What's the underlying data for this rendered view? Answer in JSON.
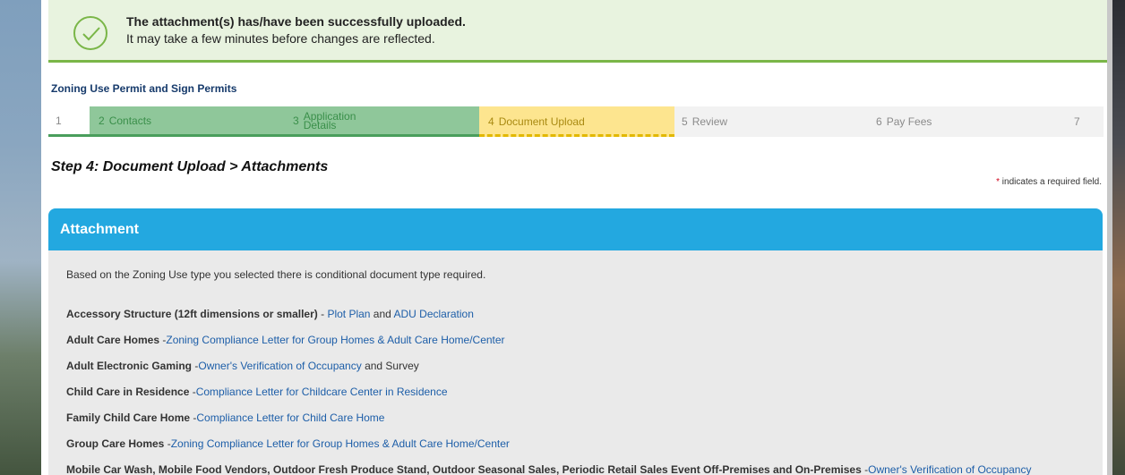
{
  "notice": {
    "title": "The attachment(s) has/have been successfully uploaded.",
    "subtitle": "It may take a few minutes before changes are reflected.",
    "icon": "check-circle-icon",
    "color": "#7ab648"
  },
  "permit_title": "Zoning Use Permit and Sign Permits",
  "steps": [
    {
      "num": "1",
      "label": "",
      "state": "done-partial"
    },
    {
      "num": "2",
      "label": "Contacts",
      "state": "done"
    },
    {
      "num": "3",
      "label": "Application",
      "label2": "Details",
      "state": "done"
    },
    {
      "num": "4",
      "label": "Document Upload",
      "state": "active"
    },
    {
      "num": "5",
      "label": "Review",
      "state": "pending"
    },
    {
      "num": "6",
      "label": "Pay Fees",
      "state": "pending"
    },
    {
      "num": "7",
      "label": "",
      "state": "pending"
    }
  ],
  "step_heading": "Step 4: Document Upload > Attachments",
  "required_note": {
    "star": "*",
    "text": " indicates a required field."
  },
  "panel": {
    "title": "Attachment",
    "intro": "Based on the Zoning Use type you selected there is conditional document type required.",
    "rows": [
      {
        "label": "Accessory Structure (12ft dimensions or smaller)",
        "sep": " - ",
        "link1": "Plot Plan",
        "mid": " and ",
        "link2": "ADU Declaration",
        "tail": ""
      },
      {
        "label": "Adult Care Homes",
        "sep": " -",
        "link1": "Zoning Compliance Letter for Group Homes & Adult Care Home/Center",
        "mid": "",
        "link2": "",
        "tail": ""
      },
      {
        "label": "Adult Electronic Gaming",
        "sep": " -",
        "link1": "Owner's Verification of Occupancy",
        "mid": " and Survey",
        "link2": "",
        "tail": ""
      },
      {
        "label": "Child Care in Residence",
        "sep": " -",
        "link1": "Compliance Letter for Childcare Center in Residence",
        "mid": "",
        "link2": "",
        "tail": ""
      },
      {
        "label": "Family Child Care Home",
        "sep": " -",
        "link1": "Compliance Letter for Child Care Home",
        "mid": "",
        "link2": "",
        "tail": ""
      },
      {
        "label": "Group Care Homes",
        "sep": " -",
        "link1": "Zoning Compliance Letter for Group Homes & Adult Care Home/Center",
        "mid": "",
        "link2": "",
        "tail": ""
      },
      {
        "label": "Mobile Car Wash, Mobile Food Vendors, Outdoor Fresh Produce Stand, Outdoor Seasonal Sales, Periodic Retail Sales Event Off-Premises and On-Premises",
        "sep": " -",
        "link1": "Owner's Verification of Occupancy",
        "mid": "",
        "link2": "",
        "tail": ""
      }
    ]
  }
}
